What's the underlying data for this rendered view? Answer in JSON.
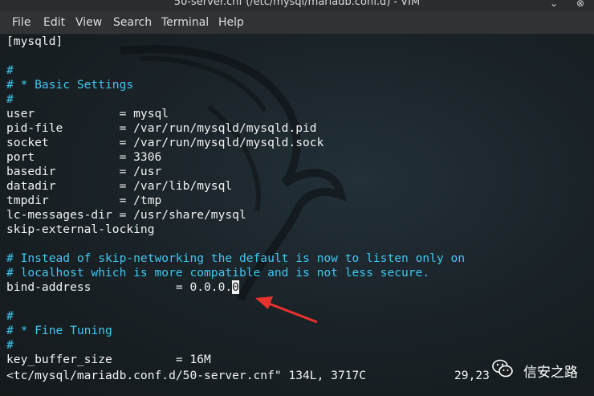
{
  "window": {
    "title": "50-server.cnf (/etc/mysql/mariadb.conf.d) - VIM",
    "minimize_glyph": "⌄",
    "close_glyph": "⊗"
  },
  "menu": [
    "File",
    "Edit",
    "View",
    "Search",
    "Terminal",
    "Help"
  ],
  "editor": {
    "lines": [
      {
        "text": "[mysqld]",
        "kind": "text"
      },
      {
        "text": "",
        "kind": "text"
      },
      {
        "text": "#",
        "kind": "comment"
      },
      {
        "text": "# * Basic Settings",
        "kind": "comment"
      },
      {
        "text": "#",
        "kind": "comment"
      },
      {
        "text": "user            = mysql",
        "kind": "text"
      },
      {
        "text": "pid-file        = /var/run/mysqld/mysqld.pid",
        "kind": "text"
      },
      {
        "text": "socket          = /var/run/mysqld/mysqld.sock",
        "kind": "text"
      },
      {
        "text": "port            = 3306",
        "kind": "text"
      },
      {
        "text": "basedir         = /usr",
        "kind": "text"
      },
      {
        "text": "datadir         = /var/lib/mysql",
        "kind": "text"
      },
      {
        "text": "tmpdir          = /tmp",
        "kind": "text"
      },
      {
        "text": "lc-messages-dir = /usr/share/mysql",
        "kind": "text"
      },
      {
        "text": "skip-external-locking",
        "kind": "text"
      },
      {
        "text": "",
        "kind": "text"
      },
      {
        "text": "# Instead of skip-networking the default is now to listen only on",
        "kind": "comment"
      },
      {
        "text": "# localhost which is more compatible and is not less secure.",
        "kind": "comment"
      },
      {
        "text": "bind-address            = 0.0.0.",
        "kind": "text",
        "cursor_char": "0"
      },
      {
        "text": "",
        "kind": "text"
      },
      {
        "text": "#",
        "kind": "comment"
      },
      {
        "text": "# * Fine Tuning",
        "kind": "comment"
      },
      {
        "text": "#",
        "kind": "comment"
      },
      {
        "text": "key_buffer_size         = 16M",
        "kind": "text"
      }
    ],
    "status_file": "<tc/mysql/mariadb.conf.d/50-server.cnf\" 134L, 3717C",
    "status_pos": "29,23"
  },
  "watermark": {
    "text": "信安之路",
    "icon": "wechat-icon"
  },
  "colors": {
    "comment": "#3fc7ef",
    "text": "#f2f2f2",
    "arrow": "#e8322e"
  }
}
